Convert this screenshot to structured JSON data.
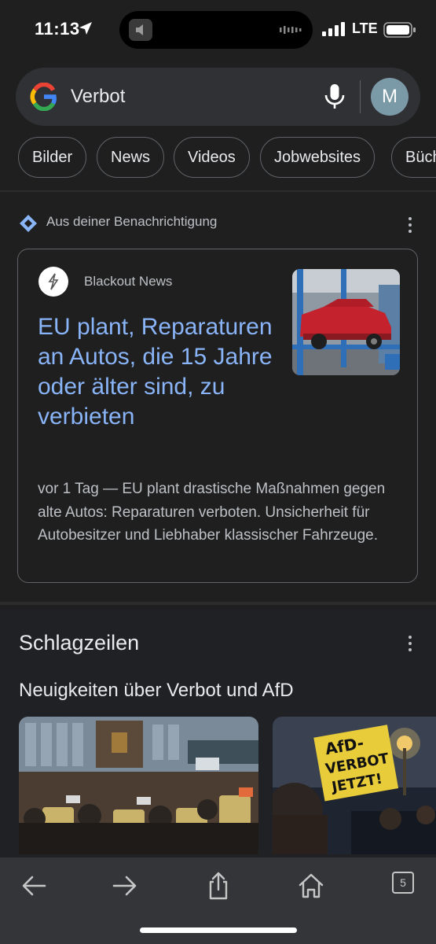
{
  "status_bar": {
    "time": "11:13",
    "network": "LTE"
  },
  "search": {
    "query": "Verbot",
    "avatar_initial": "M"
  },
  "chips": [
    "Bilder",
    "News",
    "Videos",
    "Jobwebsites",
    "Büch"
  ],
  "notification": {
    "label": "Aus deiner Benachrichtigung"
  },
  "article": {
    "source": "Blackout News",
    "headline": "EU plant, Reparaturen an Autos, die 15 Jahre oder älter sind, zu verbieten",
    "snippet": "vor 1 Tag — EU plant drastische Maßnahmen gegen alte Autos: Reparaturen verboten. Unsicherheit für Autobesitzer und Liebhaber klassischer Fahrzeuge."
  },
  "headlines_section": {
    "title": "Schlagzeilen",
    "subtitle": "Neuigkeiten über Verbot und AfD",
    "sign_text": [
      "AfD-",
      "VERBOT",
      "JETZT!"
    ]
  },
  "toolbar": {
    "tab_count": "5"
  },
  "colors": {
    "link": "#8ab4f8",
    "background": "#1f1f1f",
    "surface": "#303134"
  }
}
